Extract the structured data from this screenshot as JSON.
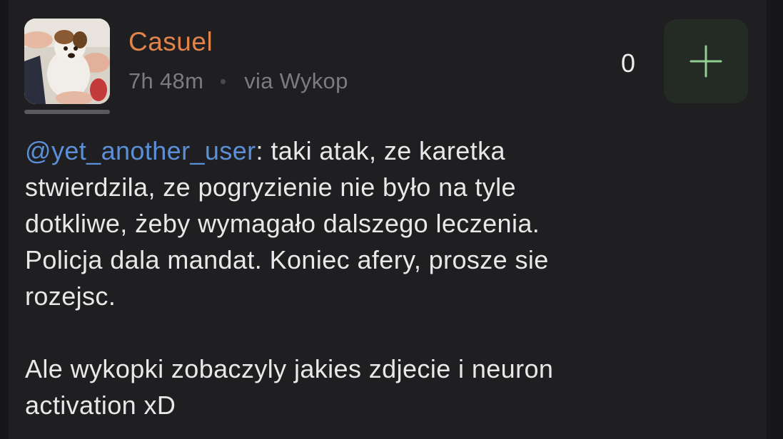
{
  "post": {
    "username": "Casuel",
    "time_ago": "7h 48m",
    "source": "via Wykop",
    "vote_count": "0",
    "mention": "@yet_another_user",
    "paragraph1_rest": ": taki atak, ze karetka\nstwierdzila, ze pogryzienie nie było na tyle\ndotkliwe, żeby wymagało dalszego leczenia.\nPolicja dala mandat. Koniec afery, prosze sie\nrozejsc.",
    "paragraph2": "Ale wykopki zobaczyly jakies zdjecie i neuron\nactivation xD"
  },
  "colors": {
    "background": "#17171a",
    "card": "#1f1f22",
    "username": "#e2834c",
    "mention": "#5b8fd8",
    "meta": "#7b7b80",
    "plus_accent": "#8fcf8f",
    "plus_button_bg": "#242a24"
  },
  "icons": {
    "avatar": "dog-photo-avatar",
    "vote": "plus-icon"
  }
}
